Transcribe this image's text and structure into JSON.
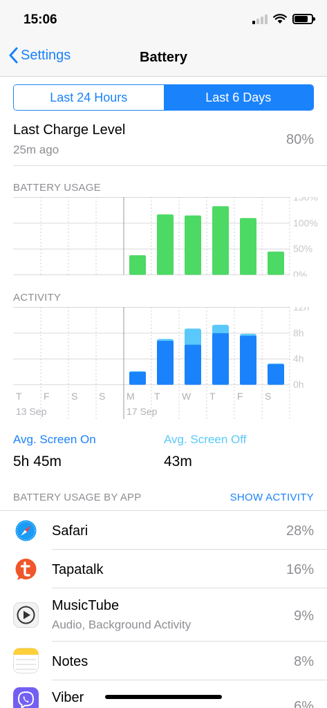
{
  "status_bar": {
    "time": "15:06"
  },
  "nav": {
    "back_label": "Settings",
    "title": "Battery"
  },
  "segments": [
    {
      "label": "Last 24 Hours",
      "active": false
    },
    {
      "label": "Last 6 Days",
      "active": true
    }
  ],
  "last_charge": {
    "title": "Last Charge Level",
    "subtitle": "25m ago",
    "value": "80%"
  },
  "battery_usage": {
    "section_label": "BATTERY USAGE"
  },
  "activity": {
    "section_label": "ACTIVITY"
  },
  "screen_time": {
    "on_label": "Avg. Screen On",
    "on_value": "5h 45m",
    "off_label": "Avg. Screen Off",
    "off_value": "43m"
  },
  "apps_section": {
    "label": "BATTERY USAGE BY APP",
    "action": "SHOW ACTIVITY"
  },
  "apps": [
    {
      "name": "Safari",
      "subtitle": "",
      "percent": "28%",
      "icon": "safari-icon"
    },
    {
      "name": "Tapatalk",
      "subtitle": "",
      "percent": "16%",
      "icon": "tapatalk-icon"
    },
    {
      "name": "MusicTube",
      "subtitle": "Audio, Background Activity",
      "percent": "9%",
      "icon": "musictube-icon"
    },
    {
      "name": "Notes",
      "subtitle": "",
      "percent": "8%",
      "icon": "notes-icon"
    },
    {
      "name": "Viber",
      "subtitle": "",
      "percent": "6%",
      "icon": "viber-icon"
    }
  ],
  "colors": {
    "accent": "#1a82fb",
    "usage_green": "#4cd964",
    "screen_on": "#1a82fb",
    "screen_off": "#5ac8fa"
  },
  "chart_data": [
    {
      "type": "bar",
      "title": "BATTERY USAGE",
      "categories": [
        "T",
        "F",
        "S",
        "S",
        "M",
        "T",
        "W",
        "T",
        "F",
        "S"
      ],
      "values": [
        0,
        0,
        0,
        0,
        38,
        117,
        115,
        133,
        110,
        45
      ],
      "ylim": [
        0,
        150
      ],
      "yticks": [
        "150%",
        "100%",
        "50%",
        "0%"
      ],
      "grid": true
    },
    {
      "type": "bar",
      "title": "ACTIVITY",
      "categories": [
        "T",
        "F",
        "S",
        "S",
        "M",
        "T",
        "W",
        "T",
        "F",
        "S"
      ],
      "date_labels": [
        "13 Sep",
        "17 Sep"
      ],
      "series": [
        {
          "name": "Avg. Screen On",
          "values": [
            0,
            0,
            0,
            0,
            2,
            6.8,
            6.2,
            8,
            7.6,
            3.2
          ]
        },
        {
          "name": "Avg. Screen Off",
          "values": [
            0,
            0,
            0,
            0,
            0.1,
            0.3,
            2.5,
            1.3,
            0.3,
            0.1
          ]
        }
      ],
      "stacked": true,
      "ylim": [
        0,
        12
      ],
      "yticks": [
        "12h",
        "8h",
        "4h",
        "0h"
      ],
      "grid": true
    }
  ]
}
